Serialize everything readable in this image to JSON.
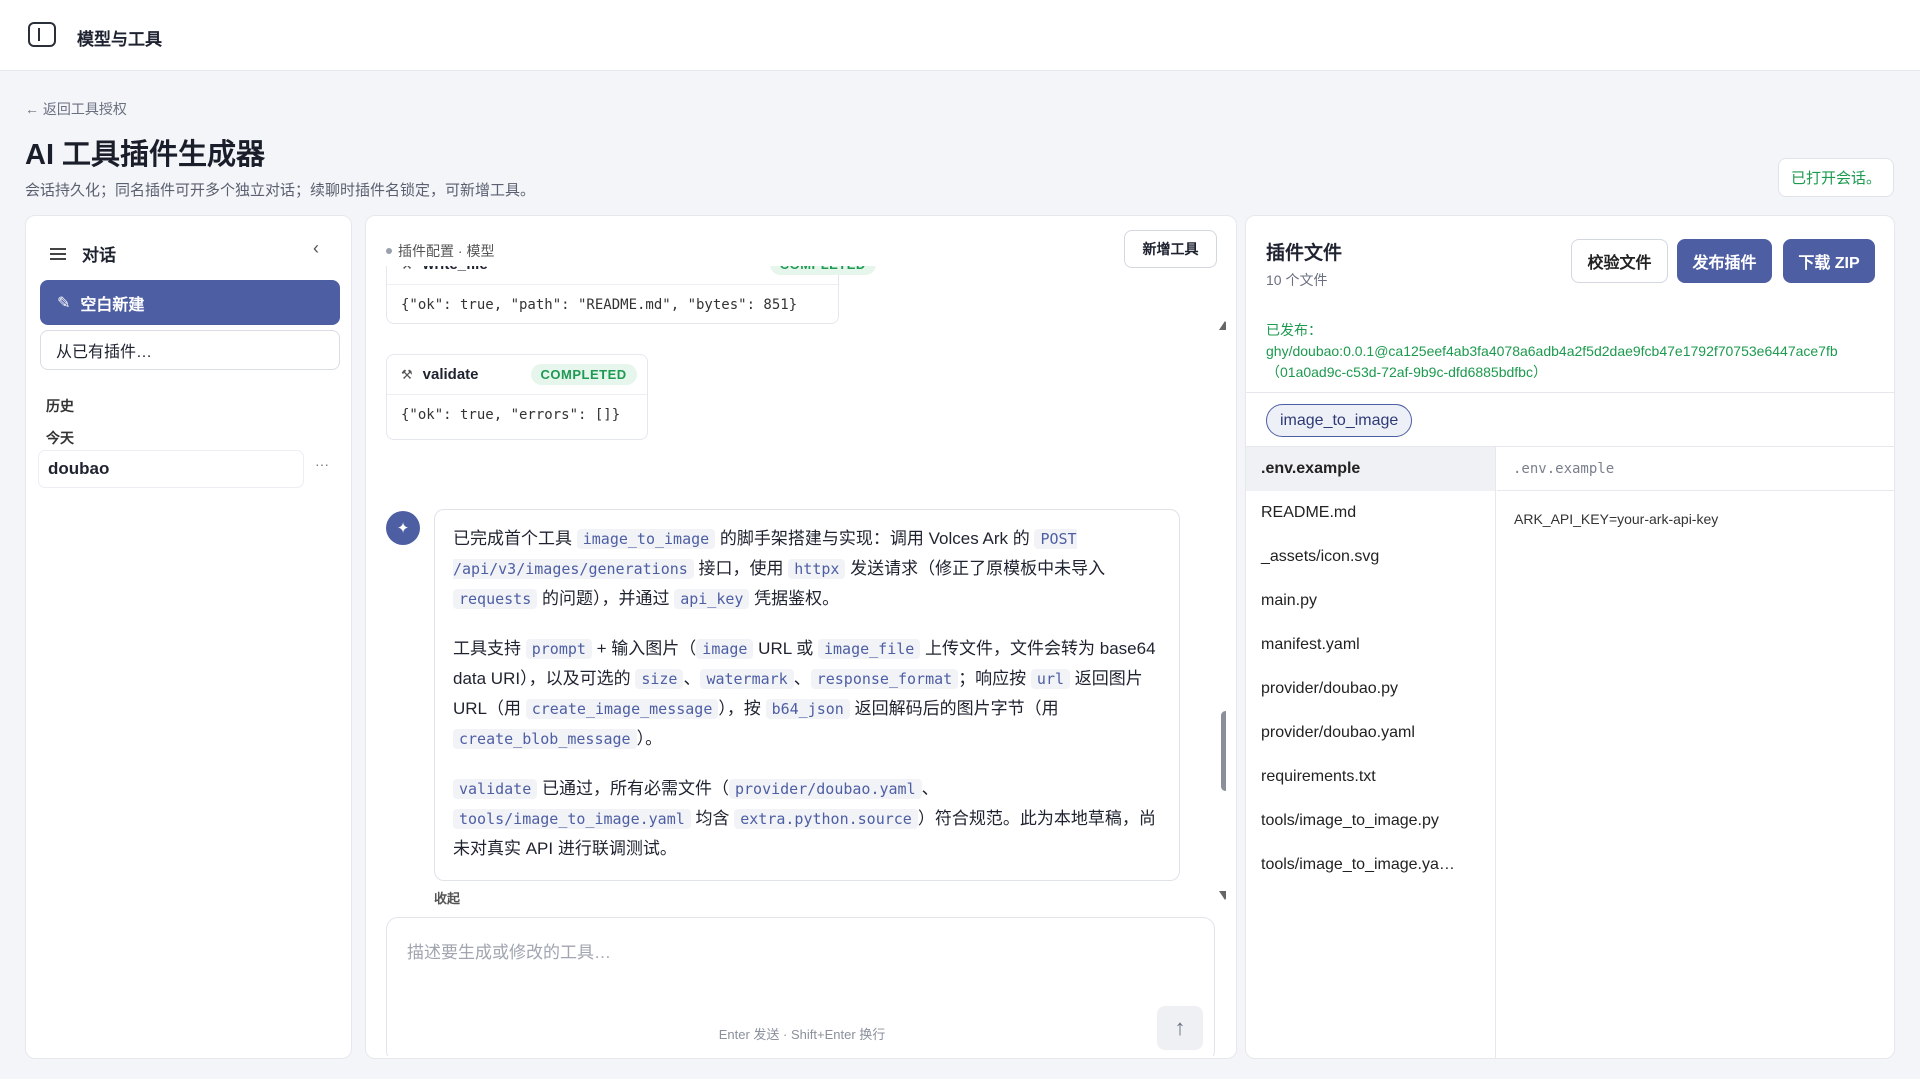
{
  "topbar": {
    "title": "模型与工具"
  },
  "header": {
    "back_link": "← 返回工具授权",
    "title": "AI 工具插件生成器",
    "subtitle": "会话持久化；同名插件可开多个独立对话；续聊时插件名锁定，可新增工具。",
    "session_status": "已打开会话。"
  },
  "sidebar": {
    "title": "对话",
    "new_blank": "空白新建",
    "from_plugin": "从已有插件…",
    "history_label": "历史",
    "today_label": "今天",
    "conversations": [
      {
        "name": "doubao",
        "more": "···"
      }
    ]
  },
  "chat": {
    "meta": "插件配置 · 模型",
    "new_tool_label": "新增工具",
    "tool_calls": [
      {
        "name": "write_file",
        "status": "COMPLETED",
        "output": "{\"ok\": true, \"path\": \"README.md\", \"bytes\": 851}"
      },
      {
        "name": "validate",
        "status": "COMPLETED",
        "output": "{\"ok\": true, \"errors\": []}"
      }
    ],
    "message": {
      "p1": [
        "已完成首个工具 ",
        "image_to_image",
        " 的脚手架搭建与实现：调用 Volces Ark 的 ",
        "POST /api/v3/images/generations",
        " 接口，使用 ",
        "httpx",
        " 发送请求（修正了原模板中未导入 ",
        "requests",
        " 的问题），并通过 ",
        "api_key",
        " 凭据鉴权。"
      ],
      "p2": [
        "工具支持 ",
        "prompt",
        " + 输入图片（",
        "image",
        " URL 或 ",
        "image_file",
        " 上传文件，文件会转为 base64 data URI），以及可选的 ",
        "size",
        "、",
        "watermark",
        "、",
        "response_format",
        "；响应按 ",
        "url",
        " 返回图片 URL（用 ",
        "create_image_message",
        "），按 ",
        "b64_json",
        " 返回解码后的图片字节（用 ",
        "create_blob_message",
        "）。"
      ],
      "p3": [
        "",
        "validate",
        " 已通过，所有必需文件（",
        "provider/doubao.yaml",
        "、",
        "tools/image_to_image.yaml",
        " 均含 ",
        "extra.python.source",
        "）符合规范。此为本地草稿，尚未对真实 API 进行联调测试。"
      ]
    },
    "collapse_label": "收起",
    "composer_placeholder": "描述要生成或修改的工具…",
    "send_icon": "↑",
    "hint": "Enter 发送 · Shift+Enter 换行"
  },
  "files_panel": {
    "title": "插件文件",
    "count": "10 个文件",
    "validate_label": "校验文件",
    "publish_label": "发布插件",
    "download_label": "下载 ZIP",
    "published_label": "已发布：",
    "published_id": "ghy/doubao:0.0.1@ca125eef4ab3fa4078a6adb4a2f5d2dae9fcb47e1792f70753e6447ace7fb",
    "published_uuid": "（01a0ad9c-c53d-72af-9b9c-dfd6885bdfbc）",
    "tool_chip": "image_to_image",
    "files": [
      ".env.example",
      "README.md",
      "_assets/icon.svg",
      "main.py",
      "manifest.yaml",
      "provider/doubao.py",
      "provider/doubao.yaml",
      "requirements.txt",
      "tools/image_to_image.py",
      "tools/image_to_image.ya…"
    ],
    "active_file": ".env.example",
    "file_content": "ARK_API_KEY=your-ark-api-key"
  },
  "colors": {
    "accent": "#4e5ea3",
    "success": "#1c9a4e"
  }
}
